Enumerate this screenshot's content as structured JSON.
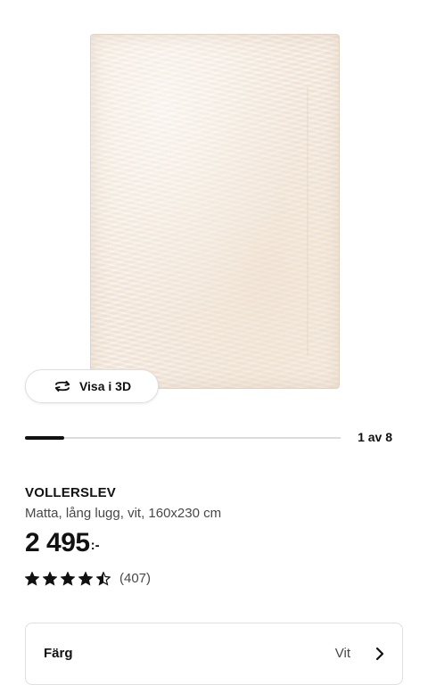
{
  "gallery": {
    "view_3d_label": "Visa i 3D",
    "pager_text": "1 av 8",
    "current_image": 1,
    "total_images": 8
  },
  "product": {
    "name": "VOLLERSLEV",
    "description": "Matta, lång lugg, vit, 160x230 cm",
    "price": "2 495",
    "price_suffix": ":-",
    "rating": 4.5,
    "rating_max": 5,
    "review_count": "(407)"
  },
  "color_selector": {
    "label": "Färg",
    "value": "Vit"
  },
  "icons": {
    "view_3d": "rotate-3d-icon",
    "star": "star-icon",
    "chevron": "chevron-right-icon"
  },
  "colors": {
    "accent": "#111111",
    "muted_text": "#484848",
    "border": "#dfdfdf",
    "rug": "#f3e8dc"
  }
}
